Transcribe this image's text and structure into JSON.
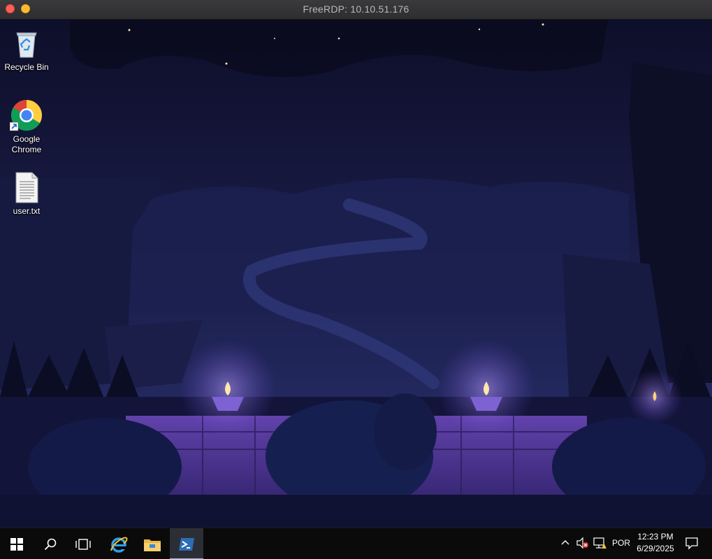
{
  "window": {
    "title": "FreeRDP: 10.10.51.176"
  },
  "desktop_icons": [
    {
      "label": "Recycle Bin",
      "icon": "recycle-bin-icon"
    },
    {
      "label": "Google Chrome",
      "icon": "chrome-icon"
    },
    {
      "label": "user.txt",
      "icon": "text-file-icon"
    }
  ],
  "taskbar": {
    "items": [
      {
        "name": "start",
        "icon": "windows-logo-icon"
      },
      {
        "name": "search",
        "icon": "search-icon"
      },
      {
        "name": "task-view",
        "icon": "task-view-icon"
      },
      {
        "name": "internet-explorer",
        "icon": "internet-explorer-icon"
      },
      {
        "name": "file-explorer",
        "icon": "folder-icon"
      },
      {
        "name": "powershell",
        "icon": "powershell-icon",
        "active": true
      }
    ],
    "tray": {
      "language": "POR",
      "time": "12:23 PM",
      "date": "6/29/2025"
    }
  },
  "colors": {
    "accent": "#76b9ed",
    "taskbar": "#0a0a0b",
    "titlebar": "#323234"
  }
}
